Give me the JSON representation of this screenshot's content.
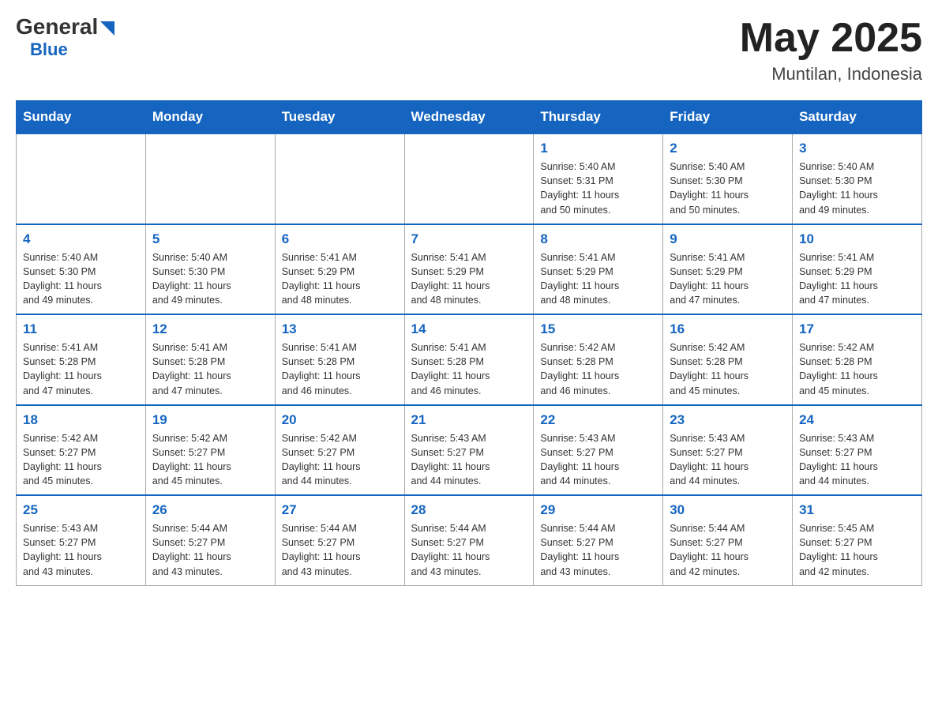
{
  "header": {
    "logo_general": "General",
    "logo_blue": "Blue",
    "month_title": "May 2025",
    "location": "Muntilan, Indonesia"
  },
  "days_of_week": [
    "Sunday",
    "Monday",
    "Tuesday",
    "Wednesday",
    "Thursday",
    "Friday",
    "Saturday"
  ],
  "weeks": [
    [
      {
        "day": "",
        "info": ""
      },
      {
        "day": "",
        "info": ""
      },
      {
        "day": "",
        "info": ""
      },
      {
        "day": "",
        "info": ""
      },
      {
        "day": "1",
        "info": "Sunrise: 5:40 AM\nSunset: 5:31 PM\nDaylight: 11 hours\nand 50 minutes."
      },
      {
        "day": "2",
        "info": "Sunrise: 5:40 AM\nSunset: 5:30 PM\nDaylight: 11 hours\nand 50 minutes."
      },
      {
        "day": "3",
        "info": "Sunrise: 5:40 AM\nSunset: 5:30 PM\nDaylight: 11 hours\nand 49 minutes."
      }
    ],
    [
      {
        "day": "4",
        "info": "Sunrise: 5:40 AM\nSunset: 5:30 PM\nDaylight: 11 hours\nand 49 minutes."
      },
      {
        "day": "5",
        "info": "Sunrise: 5:40 AM\nSunset: 5:30 PM\nDaylight: 11 hours\nand 49 minutes."
      },
      {
        "day": "6",
        "info": "Sunrise: 5:41 AM\nSunset: 5:29 PM\nDaylight: 11 hours\nand 48 minutes."
      },
      {
        "day": "7",
        "info": "Sunrise: 5:41 AM\nSunset: 5:29 PM\nDaylight: 11 hours\nand 48 minutes."
      },
      {
        "day": "8",
        "info": "Sunrise: 5:41 AM\nSunset: 5:29 PM\nDaylight: 11 hours\nand 48 minutes."
      },
      {
        "day": "9",
        "info": "Sunrise: 5:41 AM\nSunset: 5:29 PM\nDaylight: 11 hours\nand 47 minutes."
      },
      {
        "day": "10",
        "info": "Sunrise: 5:41 AM\nSunset: 5:29 PM\nDaylight: 11 hours\nand 47 minutes."
      }
    ],
    [
      {
        "day": "11",
        "info": "Sunrise: 5:41 AM\nSunset: 5:28 PM\nDaylight: 11 hours\nand 47 minutes."
      },
      {
        "day": "12",
        "info": "Sunrise: 5:41 AM\nSunset: 5:28 PM\nDaylight: 11 hours\nand 47 minutes."
      },
      {
        "day": "13",
        "info": "Sunrise: 5:41 AM\nSunset: 5:28 PM\nDaylight: 11 hours\nand 46 minutes."
      },
      {
        "day": "14",
        "info": "Sunrise: 5:41 AM\nSunset: 5:28 PM\nDaylight: 11 hours\nand 46 minutes."
      },
      {
        "day": "15",
        "info": "Sunrise: 5:42 AM\nSunset: 5:28 PM\nDaylight: 11 hours\nand 46 minutes."
      },
      {
        "day": "16",
        "info": "Sunrise: 5:42 AM\nSunset: 5:28 PM\nDaylight: 11 hours\nand 45 minutes."
      },
      {
        "day": "17",
        "info": "Sunrise: 5:42 AM\nSunset: 5:28 PM\nDaylight: 11 hours\nand 45 minutes."
      }
    ],
    [
      {
        "day": "18",
        "info": "Sunrise: 5:42 AM\nSunset: 5:27 PM\nDaylight: 11 hours\nand 45 minutes."
      },
      {
        "day": "19",
        "info": "Sunrise: 5:42 AM\nSunset: 5:27 PM\nDaylight: 11 hours\nand 45 minutes."
      },
      {
        "day": "20",
        "info": "Sunrise: 5:42 AM\nSunset: 5:27 PM\nDaylight: 11 hours\nand 44 minutes."
      },
      {
        "day": "21",
        "info": "Sunrise: 5:43 AM\nSunset: 5:27 PM\nDaylight: 11 hours\nand 44 minutes."
      },
      {
        "day": "22",
        "info": "Sunrise: 5:43 AM\nSunset: 5:27 PM\nDaylight: 11 hours\nand 44 minutes."
      },
      {
        "day": "23",
        "info": "Sunrise: 5:43 AM\nSunset: 5:27 PM\nDaylight: 11 hours\nand 44 minutes."
      },
      {
        "day": "24",
        "info": "Sunrise: 5:43 AM\nSunset: 5:27 PM\nDaylight: 11 hours\nand 44 minutes."
      }
    ],
    [
      {
        "day": "25",
        "info": "Sunrise: 5:43 AM\nSunset: 5:27 PM\nDaylight: 11 hours\nand 43 minutes."
      },
      {
        "day": "26",
        "info": "Sunrise: 5:44 AM\nSunset: 5:27 PM\nDaylight: 11 hours\nand 43 minutes."
      },
      {
        "day": "27",
        "info": "Sunrise: 5:44 AM\nSunset: 5:27 PM\nDaylight: 11 hours\nand 43 minutes."
      },
      {
        "day": "28",
        "info": "Sunrise: 5:44 AM\nSunset: 5:27 PM\nDaylight: 11 hours\nand 43 minutes."
      },
      {
        "day": "29",
        "info": "Sunrise: 5:44 AM\nSunset: 5:27 PM\nDaylight: 11 hours\nand 43 minutes."
      },
      {
        "day": "30",
        "info": "Sunrise: 5:44 AM\nSunset: 5:27 PM\nDaylight: 11 hours\nand 42 minutes."
      },
      {
        "day": "31",
        "info": "Sunrise: 5:45 AM\nSunset: 5:27 PM\nDaylight: 11 hours\nand 42 minutes."
      }
    ]
  ]
}
